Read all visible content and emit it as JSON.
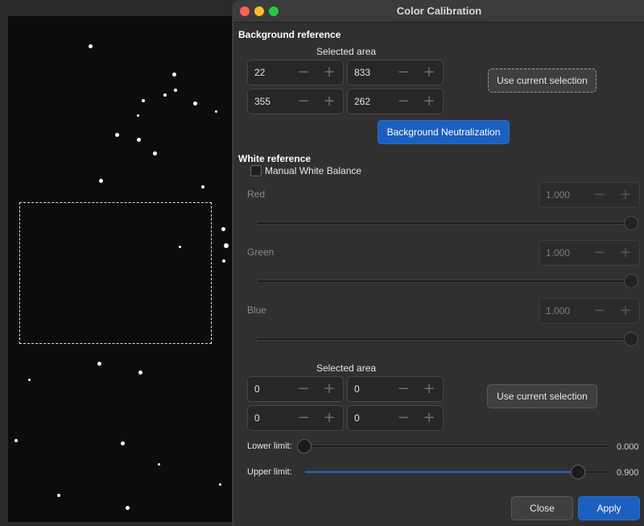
{
  "window": {
    "title": "Color Calibration"
  },
  "background_reference": {
    "title": "Background reference",
    "selected_area_label": "Selected area",
    "fields": [
      "22",
      "833",
      "355",
      "262"
    ],
    "use_selection_label": "Use current selection",
    "neutralize_label": "Background Neutralization"
  },
  "white_reference": {
    "title": "White reference",
    "manual_wb_label": "Manual White Balance",
    "manual_wb_checked": false,
    "channels": [
      {
        "label": "Red",
        "value": "1.000",
        "level": 1.0
      },
      {
        "label": "Green",
        "value": "1.000",
        "level": 1.0
      },
      {
        "label": "Blue",
        "value": "1.000",
        "level": 1.0
      }
    ],
    "selected_area_label": "Selected area",
    "fields": [
      "0",
      "0",
      "0",
      "0"
    ],
    "use_selection_label": "Use current selection",
    "lower_limit": {
      "label": "Lower limit:",
      "value": "0.000",
      "level": 0.0
    },
    "upper_limit": {
      "label": "Upper limit:",
      "value": "0.900",
      "level": 0.9
    }
  },
  "footer": {
    "close_label": "Close",
    "apply_label": "Apply"
  },
  "colors": {
    "accent": "#1c5fbf",
    "close_light": "#ff5f57",
    "minimize_light": "#febc2e",
    "zoom_light": "#28c840"
  }
}
